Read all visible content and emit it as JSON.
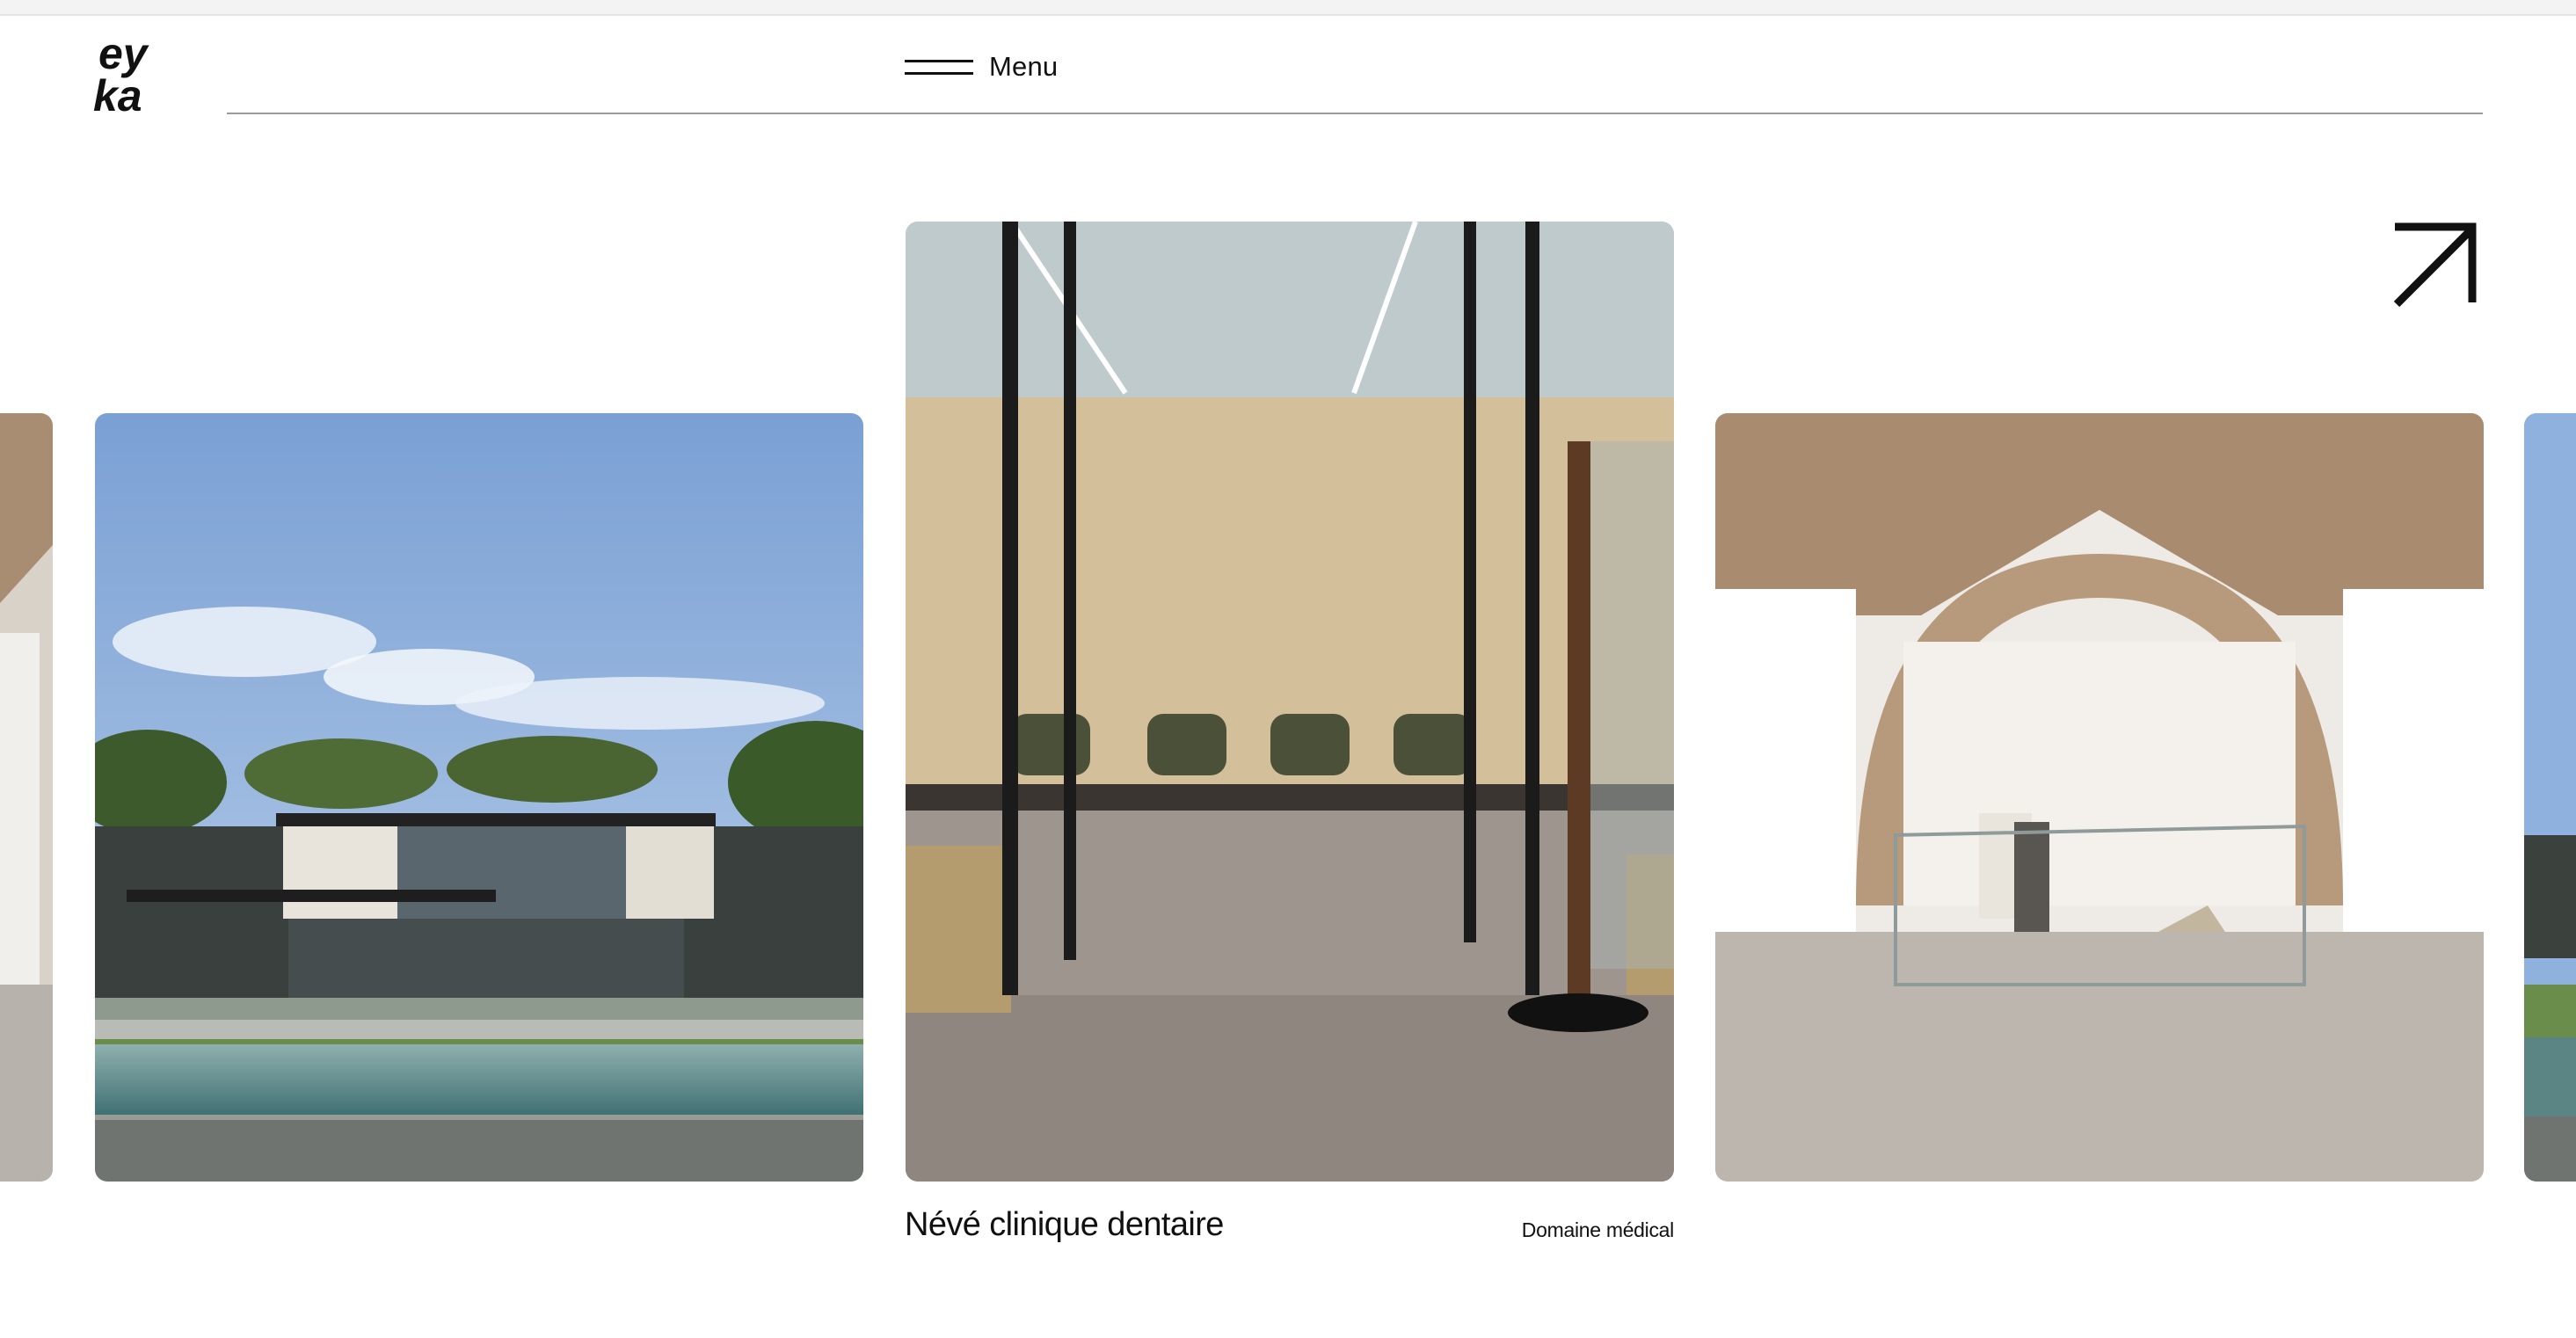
{
  "brand": {
    "logo_text": "eyka"
  },
  "header": {
    "menu_label": "Menu"
  },
  "featured_project": {
    "title": "Névé clinique dentaire",
    "category": "Domaine médical"
  },
  "icons": {
    "menu": "hamburger-icon",
    "open": "arrow-up-right-icon"
  },
  "colors": {
    "text": "#111111",
    "background": "#ffffff",
    "rule": "#9a9a9a"
  }
}
